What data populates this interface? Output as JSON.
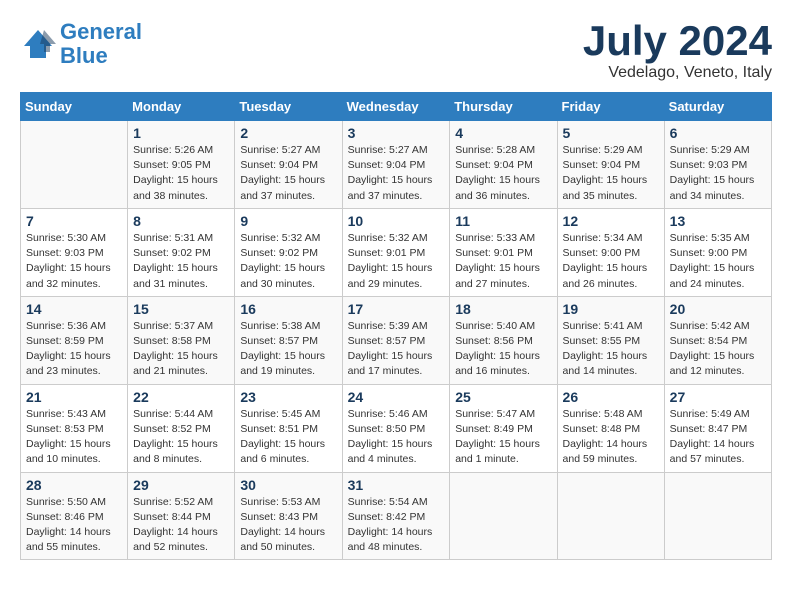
{
  "header": {
    "logo_line1": "General",
    "logo_line2": "Blue",
    "month": "July 2024",
    "location": "Vedelago, Veneto, Italy"
  },
  "days_of_week": [
    "Sunday",
    "Monday",
    "Tuesday",
    "Wednesday",
    "Thursday",
    "Friday",
    "Saturday"
  ],
  "weeks": [
    [
      {
        "day": "",
        "info": ""
      },
      {
        "day": "1",
        "info": "Sunrise: 5:26 AM\nSunset: 9:05 PM\nDaylight: 15 hours\nand 38 minutes."
      },
      {
        "day": "2",
        "info": "Sunrise: 5:27 AM\nSunset: 9:04 PM\nDaylight: 15 hours\nand 37 minutes."
      },
      {
        "day": "3",
        "info": "Sunrise: 5:27 AM\nSunset: 9:04 PM\nDaylight: 15 hours\nand 37 minutes."
      },
      {
        "day": "4",
        "info": "Sunrise: 5:28 AM\nSunset: 9:04 PM\nDaylight: 15 hours\nand 36 minutes."
      },
      {
        "day": "5",
        "info": "Sunrise: 5:29 AM\nSunset: 9:04 PM\nDaylight: 15 hours\nand 35 minutes."
      },
      {
        "day": "6",
        "info": "Sunrise: 5:29 AM\nSunset: 9:03 PM\nDaylight: 15 hours\nand 34 minutes."
      }
    ],
    [
      {
        "day": "7",
        "info": "Sunrise: 5:30 AM\nSunset: 9:03 PM\nDaylight: 15 hours\nand 32 minutes."
      },
      {
        "day": "8",
        "info": "Sunrise: 5:31 AM\nSunset: 9:02 PM\nDaylight: 15 hours\nand 31 minutes."
      },
      {
        "day": "9",
        "info": "Sunrise: 5:32 AM\nSunset: 9:02 PM\nDaylight: 15 hours\nand 30 minutes."
      },
      {
        "day": "10",
        "info": "Sunrise: 5:32 AM\nSunset: 9:01 PM\nDaylight: 15 hours\nand 29 minutes."
      },
      {
        "day": "11",
        "info": "Sunrise: 5:33 AM\nSunset: 9:01 PM\nDaylight: 15 hours\nand 27 minutes."
      },
      {
        "day": "12",
        "info": "Sunrise: 5:34 AM\nSunset: 9:00 PM\nDaylight: 15 hours\nand 26 minutes."
      },
      {
        "day": "13",
        "info": "Sunrise: 5:35 AM\nSunset: 9:00 PM\nDaylight: 15 hours\nand 24 minutes."
      }
    ],
    [
      {
        "day": "14",
        "info": "Sunrise: 5:36 AM\nSunset: 8:59 PM\nDaylight: 15 hours\nand 23 minutes."
      },
      {
        "day": "15",
        "info": "Sunrise: 5:37 AM\nSunset: 8:58 PM\nDaylight: 15 hours\nand 21 minutes."
      },
      {
        "day": "16",
        "info": "Sunrise: 5:38 AM\nSunset: 8:57 PM\nDaylight: 15 hours\nand 19 minutes."
      },
      {
        "day": "17",
        "info": "Sunrise: 5:39 AM\nSunset: 8:57 PM\nDaylight: 15 hours\nand 17 minutes."
      },
      {
        "day": "18",
        "info": "Sunrise: 5:40 AM\nSunset: 8:56 PM\nDaylight: 15 hours\nand 16 minutes."
      },
      {
        "day": "19",
        "info": "Sunrise: 5:41 AM\nSunset: 8:55 PM\nDaylight: 15 hours\nand 14 minutes."
      },
      {
        "day": "20",
        "info": "Sunrise: 5:42 AM\nSunset: 8:54 PM\nDaylight: 15 hours\nand 12 minutes."
      }
    ],
    [
      {
        "day": "21",
        "info": "Sunrise: 5:43 AM\nSunset: 8:53 PM\nDaylight: 15 hours\nand 10 minutes."
      },
      {
        "day": "22",
        "info": "Sunrise: 5:44 AM\nSunset: 8:52 PM\nDaylight: 15 hours\nand 8 minutes."
      },
      {
        "day": "23",
        "info": "Sunrise: 5:45 AM\nSunset: 8:51 PM\nDaylight: 15 hours\nand 6 minutes."
      },
      {
        "day": "24",
        "info": "Sunrise: 5:46 AM\nSunset: 8:50 PM\nDaylight: 15 hours\nand 4 minutes."
      },
      {
        "day": "25",
        "info": "Sunrise: 5:47 AM\nSunset: 8:49 PM\nDaylight: 15 hours\nand 1 minute."
      },
      {
        "day": "26",
        "info": "Sunrise: 5:48 AM\nSunset: 8:48 PM\nDaylight: 14 hours\nand 59 minutes."
      },
      {
        "day": "27",
        "info": "Sunrise: 5:49 AM\nSunset: 8:47 PM\nDaylight: 14 hours\nand 57 minutes."
      }
    ],
    [
      {
        "day": "28",
        "info": "Sunrise: 5:50 AM\nSunset: 8:46 PM\nDaylight: 14 hours\nand 55 minutes."
      },
      {
        "day": "29",
        "info": "Sunrise: 5:52 AM\nSunset: 8:44 PM\nDaylight: 14 hours\nand 52 minutes."
      },
      {
        "day": "30",
        "info": "Sunrise: 5:53 AM\nSunset: 8:43 PM\nDaylight: 14 hours\nand 50 minutes."
      },
      {
        "day": "31",
        "info": "Sunrise: 5:54 AM\nSunset: 8:42 PM\nDaylight: 14 hours\nand 48 minutes."
      },
      {
        "day": "",
        "info": ""
      },
      {
        "day": "",
        "info": ""
      },
      {
        "day": "",
        "info": ""
      }
    ]
  ]
}
